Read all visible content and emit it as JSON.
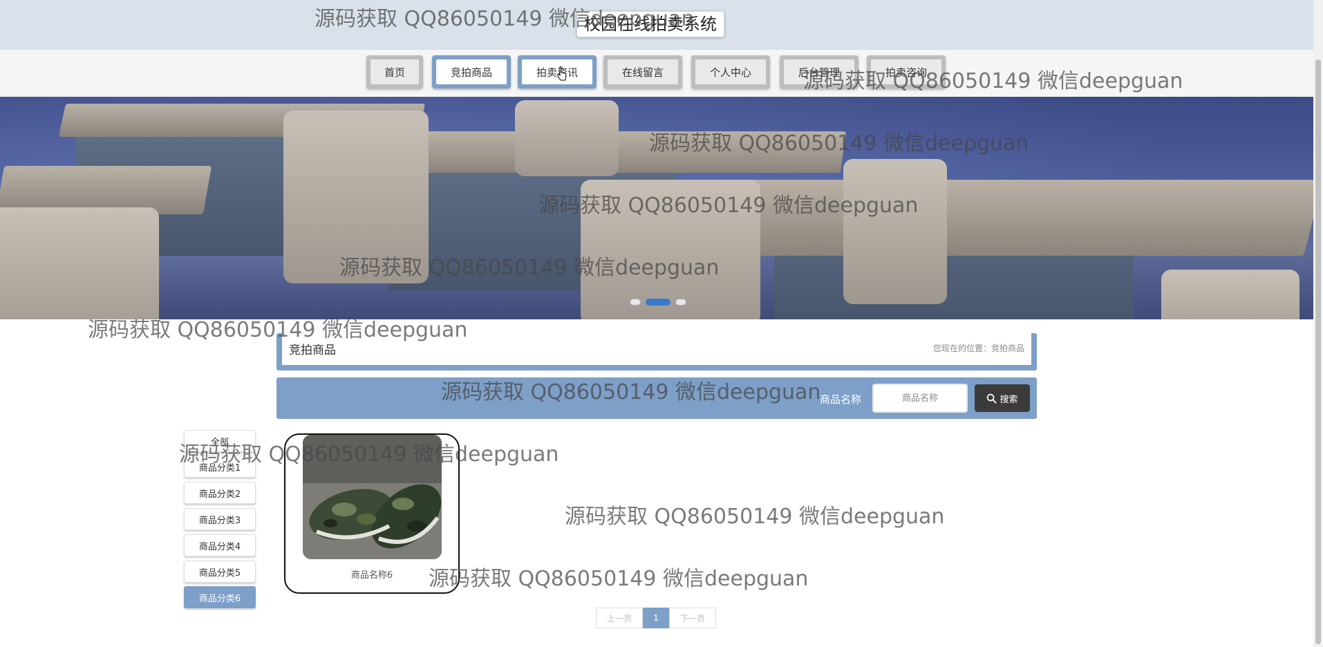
{
  "header": {
    "title": "校园在线拍卖系统"
  },
  "nav": {
    "items": [
      {
        "label": "首页"
      },
      {
        "label": "竞拍商品"
      },
      {
        "label": "拍卖资讯"
      },
      {
        "label": "在线留言"
      },
      {
        "label": "个人中心"
      },
      {
        "label": "后台管理"
      },
      {
        "label": "拍卖咨询"
      }
    ],
    "active_index": 1
  },
  "banner": {
    "dot_count": 3,
    "active_dot": 2
  },
  "breadcrumb": {
    "title": "竞拍商品",
    "location": "您现在的位置：竞拍商品"
  },
  "search": {
    "label": "商品名称",
    "placeholder": "商品名称",
    "button_label": "搜索"
  },
  "categories": [
    {
      "label": "全部"
    },
    {
      "label": "商品分类1"
    },
    {
      "label": "商品分类2"
    },
    {
      "label": "商品分类3"
    },
    {
      "label": "商品分类4"
    },
    {
      "label": "商品分类5"
    },
    {
      "label": "商品分类6"
    }
  ],
  "active_category": "商品分类6",
  "products": [
    {
      "name": "商品名称6"
    }
  ],
  "pagination": {
    "prev": "上一页",
    "current": "1",
    "next": "下一页"
  },
  "watermark": "源码获取 QQ86050149 微信deepguan",
  "colors": {
    "accent": "#7d9fc8",
    "header_bg": "#d9e2ea",
    "search_button": "#3b3b3b"
  }
}
